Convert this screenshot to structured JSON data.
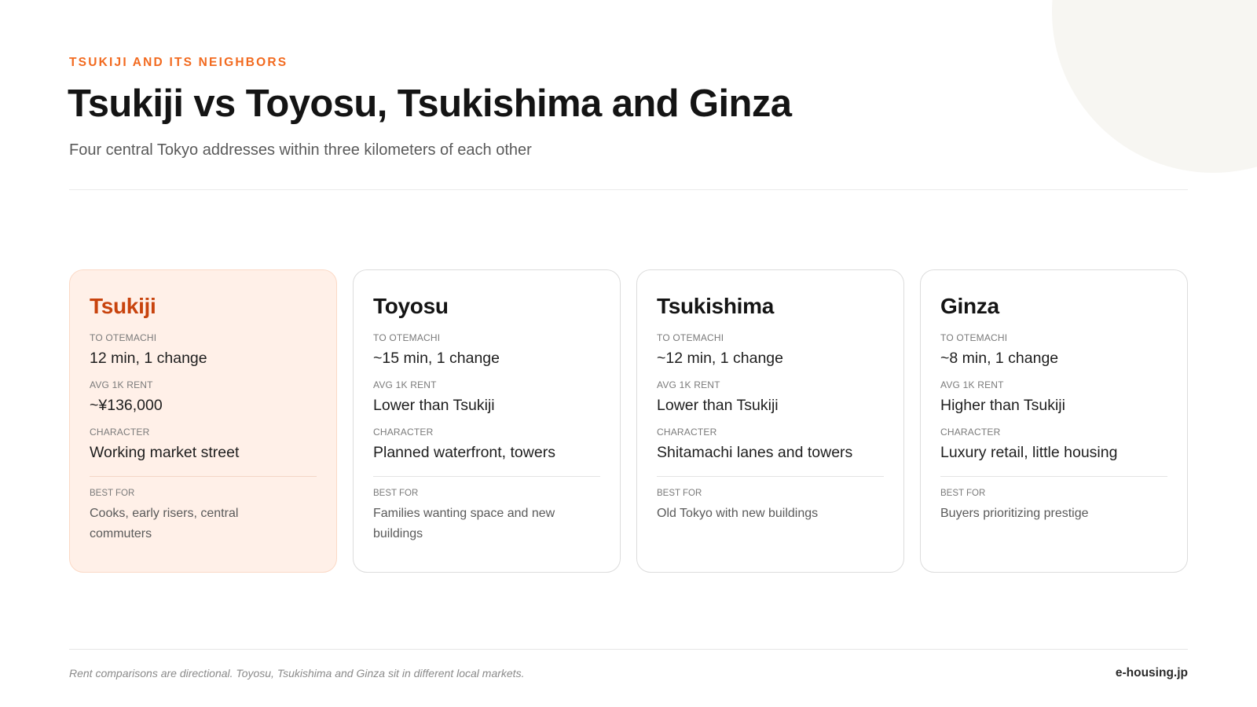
{
  "header": {
    "eyebrow": "TSUKIJI AND ITS NEIGHBORS",
    "title": "Tsukiji vs Toyosu, Tsukishima and Ginza",
    "subtitle": "Four central Tokyo addresses within three kilometers of each other"
  },
  "cards": [
    {
      "name": "Tsukiji",
      "commute_label": "TO OTEMACHI",
      "commute": "12 min, 1 change",
      "rent_label": "AVG 1K RENT",
      "rent": "~¥136,000",
      "character_label": "CHARACTER",
      "character": "Working market street",
      "best_for_label": "BEST FOR",
      "best_for": "Cooks, early risers, central commuters"
    },
    {
      "name": "Toyosu",
      "commute_label": "TO OTEMACHI",
      "commute": "~15 min, 1 change",
      "rent_label": "AVG 1K RENT",
      "rent": "Lower than Tsukiji",
      "character_label": "CHARACTER",
      "character": "Planned waterfront, towers",
      "best_for_label": "BEST FOR",
      "best_for": "Families wanting space and new buildings"
    },
    {
      "name": "Tsukishima",
      "commute_label": "TO OTEMACHI",
      "commute": "~12 min, 1 change",
      "rent_label": "AVG 1K RENT",
      "rent": "Lower than Tsukiji",
      "character_label": "CHARACTER",
      "character": "Shitamachi lanes and towers",
      "best_for_label": "BEST FOR",
      "best_for": "Old Tokyo with new buildings"
    },
    {
      "name": "Ginza",
      "commute_label": "TO OTEMACHI",
      "commute": "~8 min, 1 change",
      "rent_label": "AVG 1K RENT",
      "rent": "Higher than Tsukiji",
      "character_label": "CHARACTER",
      "character": "Luxury retail, little housing",
      "best_for_label": "BEST FOR",
      "best_for": "Buyers prioritizing prestige"
    }
  ],
  "footer": {
    "note": "Rent comparisons are directional. Toyosu, Tsukishima and Ginza sit in different local markets.",
    "brand": "e-housing.jp"
  },
  "colors": {
    "accent": "#f26a1f",
    "highlight_name": "#c8430d",
    "highlight_bg": "#fff0e8"
  }
}
